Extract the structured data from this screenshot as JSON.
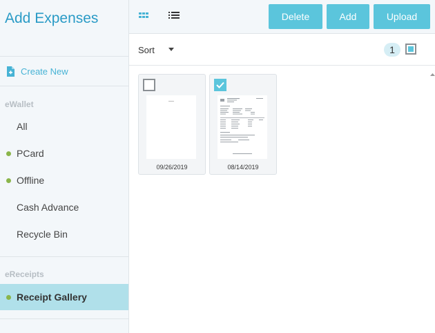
{
  "sidebar": {
    "title": "Add Expenses",
    "create_new": "Create New",
    "ewallet_label": "eWallet",
    "ewallet_items": [
      {
        "label": "All",
        "dot": false
      },
      {
        "label": "PCard",
        "dot": true
      },
      {
        "label": "Offline",
        "dot": true
      },
      {
        "label": "Cash Advance",
        "dot": false
      },
      {
        "label": "Recycle Bin",
        "dot": false
      }
    ],
    "ereceipts_label": "eReceipts",
    "ereceipts_items": [
      {
        "label": "Receipt Gallery",
        "dot": true,
        "active": true
      }
    ]
  },
  "toolbar": {
    "delete_label": "Delete",
    "add_label": "Add",
    "upload_label": "Upload",
    "grid_view_icon": "grid-icon",
    "list_view_icon": "list-icon"
  },
  "sortbar": {
    "sort_label": "Sort",
    "selected_count": "1"
  },
  "receipts": [
    {
      "date": "09/26/2019",
      "checked": false
    },
    {
      "date": "08/14/2019",
      "checked": true
    }
  ],
  "colors": {
    "accent": "#5bc5dc",
    "title": "#2a9bc6",
    "active_nav": "#b0e0ea",
    "dot": "#8ab54a"
  }
}
